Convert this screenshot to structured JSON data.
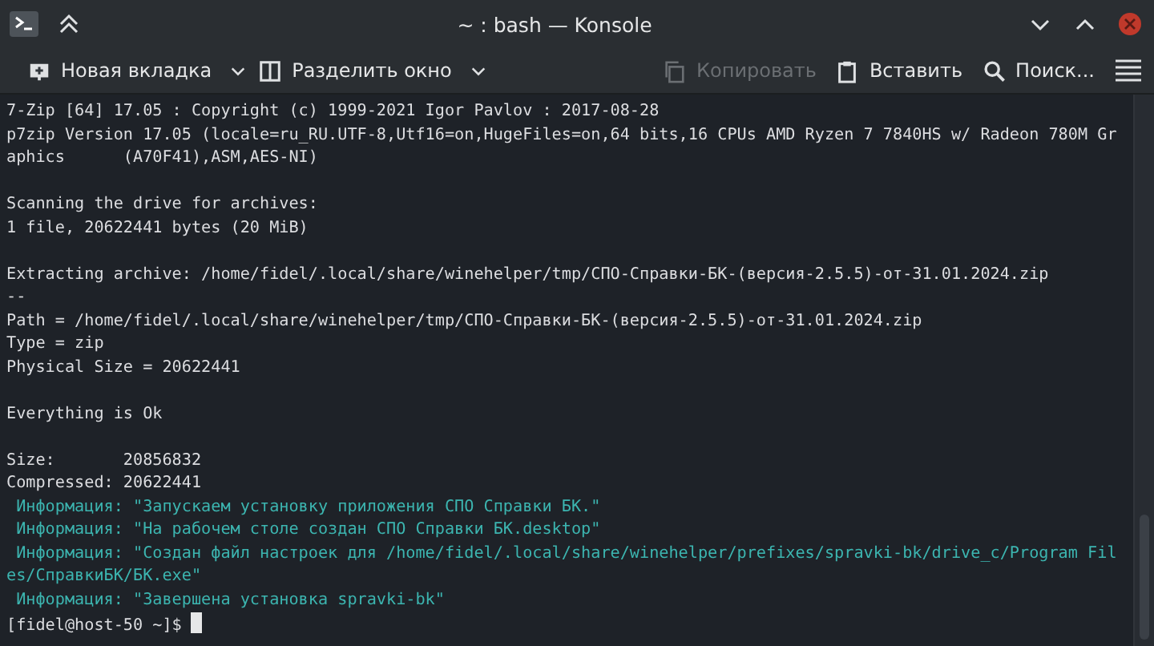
{
  "window": {
    "title": "~ : bash — Konsole"
  },
  "toolbar": [
    {
      "kind": "newtab",
      "label": "Новая вкладка",
      "disabled": false,
      "dropdown": true
    },
    {
      "kind": "split",
      "label": "Разделить окно",
      "disabled": false,
      "dropdown": true
    },
    {
      "kind": "copy",
      "label": "Копировать",
      "disabled": true,
      "dropdown": false
    },
    {
      "kind": "paste",
      "label": "Вставить",
      "disabled": false,
      "dropdown": false
    },
    {
      "kind": "search",
      "label": "Поиск...",
      "disabled": false,
      "dropdown": false
    }
  ],
  "terminal": {
    "lines": [
      {
        "kind": "output",
        "text": "7-Zip [64] 17.05 : Copyright (c) 1999-2021 Igor Pavlov : 2017-08-28"
      },
      {
        "kind": "output",
        "text": "p7zip Version 17.05 (locale=ru_RU.UTF-8,Utf16=on,HugeFiles=on,64 bits,16 CPUs AMD Ryzen 7 7840HS w/ Radeon 780M Gr"
      },
      {
        "kind": "output",
        "text": "aphics      (A70F41),ASM,AES-NI)"
      },
      {
        "kind": "blank"
      },
      {
        "kind": "output",
        "text": "Scanning the drive for archives:"
      },
      {
        "kind": "output",
        "text": "1 file, 20622441 bytes (20 MiB)"
      },
      {
        "kind": "blank"
      },
      {
        "kind": "output",
        "text": "Extracting archive: /home/fidel/.local/share/winehelper/tmp/СПО-Справки-БК-(версия-2.5.5)-от-31.01.2024.zip"
      },
      {
        "kind": "output",
        "text": "--"
      },
      {
        "kind": "output",
        "text": "Path = /home/fidel/.local/share/winehelper/tmp/СПО-Справки-БК-(версия-2.5.5)-от-31.01.2024.zip"
      },
      {
        "kind": "output",
        "text": "Type = zip"
      },
      {
        "kind": "output",
        "text": "Physical Size = 20622441"
      },
      {
        "kind": "blank"
      },
      {
        "kind": "output",
        "text": "Everything is Ok"
      },
      {
        "kind": "blank"
      },
      {
        "kind": "output",
        "text": "Size:       20856832"
      },
      {
        "kind": "output",
        "text": "Compressed: 20622441"
      },
      {
        "kind": "info",
        "text": " Информация: \"Запускаем установку приложения СПО Справки БК.\""
      },
      {
        "kind": "info",
        "text": " Информация: \"На рабочем столе создан СПО Справки БК.desktop\""
      },
      {
        "kind": "info",
        "text": " Информация: \"Создан файл настроек для /home/fidel/.local/share/winehelper/prefixes/spravki-bk/drive_c/Program Fil"
      },
      {
        "kind": "info",
        "text": "es/СправкиБК/БК.exe\""
      },
      {
        "kind": "info",
        "text": " Информация: \"Завершена установка spravki-bk\""
      },
      {
        "kind": "prompt",
        "text": "[fidel@host-50 ~]$ "
      }
    ]
  }
}
